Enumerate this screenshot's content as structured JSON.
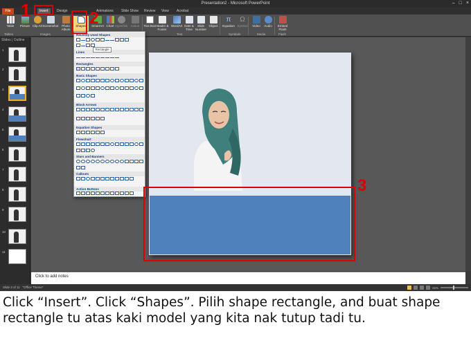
{
  "window": {
    "title": "Presentation2 - Microsoft PowerPoint",
    "buttons": [
      "–",
      "□",
      "×"
    ]
  },
  "ribbon_tabs": [
    {
      "label": "File"
    },
    {
      "label": "Insert"
    },
    {
      "label": "Design"
    },
    {
      "label": "Animations"
    },
    {
      "label": "Slide Show"
    },
    {
      "label": "Review"
    },
    {
      "label": "View"
    },
    {
      "label": "Acrobat"
    }
  ],
  "ribbon": {
    "buttons": [
      {
        "label": "Table",
        "icon": "table-icon"
      },
      {
        "label": "Picture",
        "icon": "picture-icon"
      },
      {
        "label": "Clip Art",
        "icon": "clip-art-icon"
      },
      {
        "label": "Screenshot",
        "icon": "screenshot-icon"
      },
      {
        "label": "Photo Album",
        "icon": "photo-album-icon"
      },
      {
        "label": "Shapes",
        "icon": "shapes-icon"
      },
      {
        "label": "SmartArt",
        "icon": "smartart-icon"
      },
      {
        "label": "Chart",
        "icon": "chart-icon"
      },
      {
        "label": "Hyperlink",
        "icon": "hyperlink-icon"
      },
      {
        "label": "Action",
        "icon": "action-icon"
      },
      {
        "label": "Text Box",
        "icon": "text-box-icon"
      },
      {
        "label": "Header & Footer",
        "icon": "header-footer-icon"
      },
      {
        "label": "WordArt",
        "icon": "wordart-icon"
      },
      {
        "label": "Date & Time",
        "icon": "date-time-icon"
      },
      {
        "label": "Slide Number",
        "icon": "slide-number-icon"
      },
      {
        "label": "Object",
        "icon": "object-icon"
      },
      {
        "label": "Equation",
        "icon": "equation-icon"
      },
      {
        "label": "Symbol",
        "icon": "symbol-icon"
      },
      {
        "label": "Video",
        "icon": "video-icon"
      },
      {
        "label": "Audio",
        "icon": "audio-icon"
      },
      {
        "label": "Embed Flash",
        "icon": "embed-flash-icon"
      }
    ],
    "groups": [
      "Tables",
      "Images",
      "Text",
      "Symbols",
      "Media",
      "Flash"
    ],
    "colors": {
      "ribbon_bg": "#505050",
      "file_tab": "#c4471b",
      "accent_blue": "#4f81bd"
    }
  },
  "shapes_menu": {
    "categories": [
      "Recently Used Shapes",
      "Lines",
      "Rectangles",
      "Basic Shapes",
      "Block Arrows",
      "Equation Shapes",
      "Flowchart",
      "Stars and Banners",
      "Callouts",
      "Action Buttons"
    ],
    "tooltip": "Rectangle"
  },
  "slides_pane": {
    "tabs": "Slides | Outline",
    "slide_numbers": [
      "1",
      "2",
      "3",
      "4",
      "5",
      "6",
      "7",
      "8",
      "9",
      "10",
      "11"
    ],
    "active_slide": 3
  },
  "notes_placeholder": "Click to add notes",
  "status_bar": {
    "slide_info": "Slide 3 of 11",
    "theme": "\"Office Theme\"",
    "zoom": "25%"
  },
  "annotations": {
    "step1": "1",
    "step2": "2",
    "step3": "3",
    "color": "#e00000"
  },
  "caption": "Click “Insert”. Click “Shapes”. Pilih shape rectangle, and buat shape rectangle tu atas kaki model yang kita nak tutup tadi tu."
}
